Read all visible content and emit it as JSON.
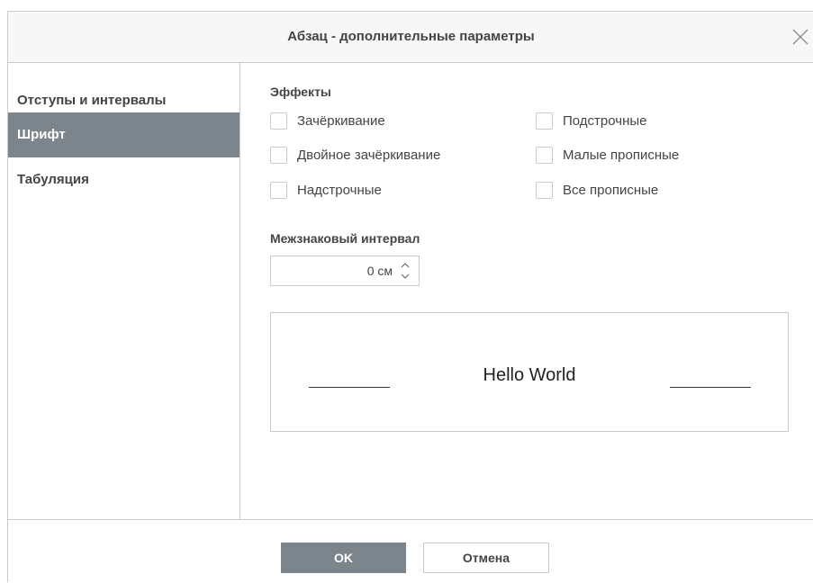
{
  "dialog": {
    "title": "Абзац - дополнительные параметры"
  },
  "icons": {
    "close": "close-icon",
    "spin_up": "chevron-up-icon",
    "spin_down": "chevron-down-icon"
  },
  "sidebar": {
    "items": [
      {
        "label": "Отступы и интервалы",
        "active": false
      },
      {
        "label": "Шрифт",
        "active": true
      },
      {
        "label": "Табуляция",
        "active": false
      }
    ]
  },
  "effects": {
    "title": "Эффекты",
    "options": [
      {
        "label": "Зачёркивание",
        "checked": false
      },
      {
        "label": "Двойное зачёркивание",
        "checked": false
      },
      {
        "label": "Надстрочные",
        "checked": false
      },
      {
        "label": "Подстрочные",
        "checked": false
      },
      {
        "label": "Малые прописные",
        "checked": false
      },
      {
        "label": "Все прописные",
        "checked": false
      }
    ]
  },
  "spacing": {
    "title": "Межзнаковый интервал",
    "value": "0 см"
  },
  "preview": {
    "text": "Hello World"
  },
  "footer": {
    "ok_label": "OK",
    "cancel_label": "Отмена"
  },
  "colors": {
    "accent": "#7d858c",
    "border": "#cbcbcb",
    "header_bg": "#f7f7f7",
    "text": "#444444"
  }
}
